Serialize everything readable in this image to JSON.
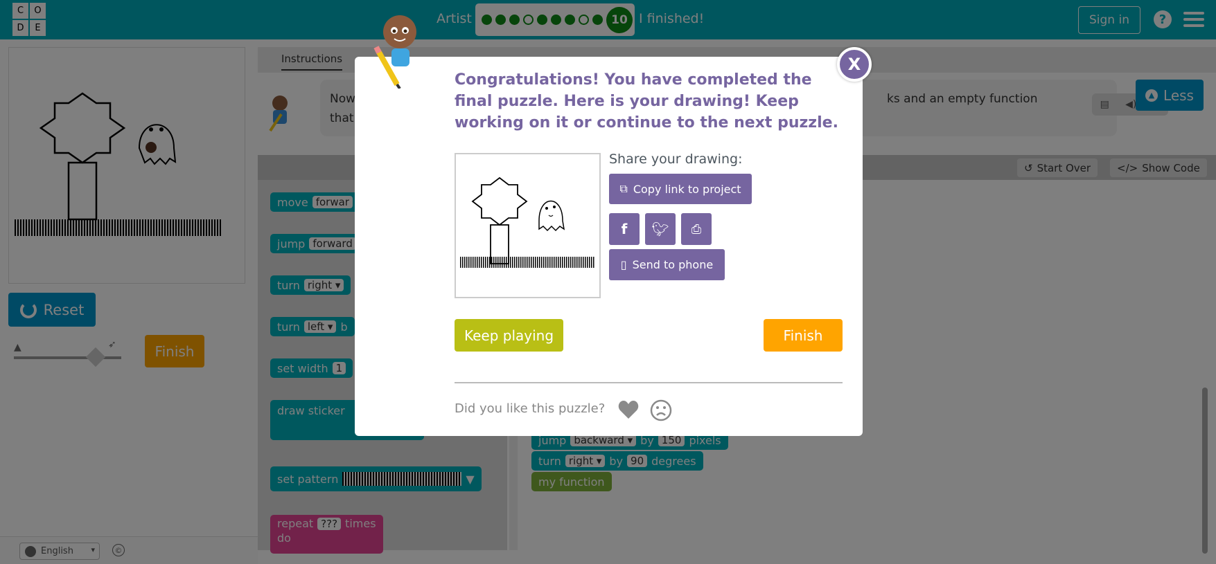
{
  "header": {
    "logo_letters": [
      "C",
      "O",
      "D",
      "E"
    ],
    "puzzle_title": "Artist",
    "progress": {
      "total": 10,
      "completed": 9,
      "hollow_indices": [
        3,
        7
      ],
      "current_label": "10"
    },
    "finished_label": "I finished!",
    "signin_label": "Sign in",
    "help_icon": "?"
  },
  "left": {
    "reset_label": "Reset",
    "finish_label": "Finish",
    "speed_turtle_icon": "turtle-icon",
    "speed_rabbit_icon": "rabbit-icon"
  },
  "footer": {
    "language": "English",
    "copyright": "©"
  },
  "instructions": {
    "tab_label": "Instructions",
    "text_visible_1": "Now",
    "text_visible_2": "that",
    "text_tail": "ks and an empty function",
    "less_label": "Less"
  },
  "workspace_header": {
    "start_over": "Start Over",
    "show_code": "Show Code"
  },
  "toolbox": {
    "blocks": [
      {
        "label": "move",
        "field": "forwar"
      },
      {
        "label": "jump",
        "field": "forward"
      },
      {
        "label": "turn",
        "field": "right ▾"
      },
      {
        "label": "turn",
        "field": "left ▾",
        "trail": "b"
      },
      {
        "label": "set width",
        "field": "1"
      },
      {
        "label": "draw sticker"
      },
      {
        "label": "set pattern"
      },
      {
        "label": "repeat",
        "field": "???",
        "trail": "times",
        "sub": "do"
      }
    ]
  },
  "workspace": {
    "blocks": [
      {
        "label": "jump",
        "field1": "backward ▾",
        "mid": "by",
        "field2": "150",
        "tail": "pixels"
      },
      {
        "label": "turn",
        "field1": "right ▾",
        "mid": "by",
        "field2": "90",
        "tail": "degrees"
      },
      {
        "label": "my function"
      }
    ]
  },
  "modal": {
    "message": "Congratulations! You have completed the final puzzle. Here is your drawing! Keep working on it or continue to the next puzzle.",
    "share_label": "Share your drawing:",
    "copy_link_label": "Copy link to project",
    "send_phone_label": "Send to phone",
    "keep_playing_label": "Keep playing",
    "finish_label": "Finish",
    "feedback_question": "Did you like this puzzle?",
    "close_label": "X"
  },
  "colors": {
    "header_bg": "#00adbc",
    "modal_accent": "#7665a0",
    "keep_playing": "#b9bf15",
    "finish": "#ffa400",
    "block_teal": "#00b0bd",
    "reset_blue": "#0094ca"
  }
}
